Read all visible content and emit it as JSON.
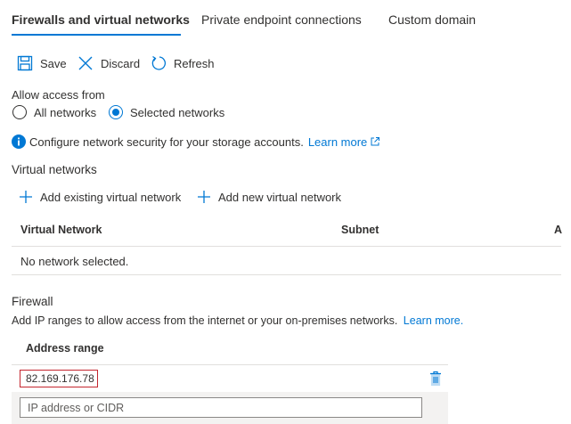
{
  "tabs": [
    {
      "label": "Firewalls and virtual networks"
    },
    {
      "label": "Private endpoint connections"
    },
    {
      "label": "Custom domain"
    }
  ],
  "toolbar": {
    "save": "Save",
    "discard": "Discard",
    "refresh": "Refresh"
  },
  "access": {
    "label": "Allow access from",
    "options": [
      "All networks",
      "Selected networks"
    ],
    "selected": "Selected networks"
  },
  "info": {
    "text": "Configure network security for your storage accounts.",
    "link": "Learn more"
  },
  "vnet": {
    "heading": "Virtual networks",
    "add_existing": "Add existing virtual network",
    "add_new": "Add new virtual network",
    "columns": [
      "Virtual Network",
      "Subnet",
      "A"
    ],
    "empty": "No network selected."
  },
  "firewall": {
    "heading": "Firewall",
    "description": "Add IP ranges to allow access from the internet or your on-premises networks.",
    "link": "Learn more.",
    "column": "Address range",
    "ip": "82.169.176.78",
    "placeholder": "IP address or CIDR"
  },
  "colors": {
    "accent": "#0078d4",
    "error_border": "#c4262e"
  }
}
